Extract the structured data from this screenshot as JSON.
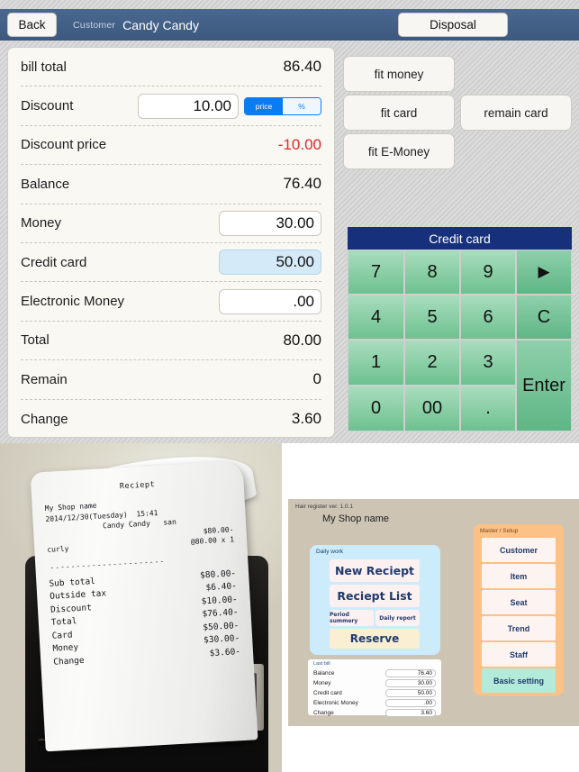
{
  "navbar": {
    "back_label": "Back",
    "customer_label": "Customer",
    "customer_name": "Candy Candy",
    "disposal_label": "Disposal"
  },
  "bill": {
    "rows": [
      {
        "label": "bill total",
        "value": "86.40"
      },
      {
        "label": "Discount",
        "value": "10.00"
      },
      {
        "label": "Discount price",
        "value": "-10.00"
      },
      {
        "label": "Balance",
        "value": "76.40"
      },
      {
        "label": "Money",
        "value": "30.00"
      },
      {
        "label": "Credit card",
        "value": "50.00"
      },
      {
        "label": "Electronic Money",
        "value": ".00"
      },
      {
        "label": "Total",
        "value": "80.00"
      },
      {
        "label": "Remain",
        "value": "0"
      },
      {
        "label": "Change",
        "value": "3.60"
      }
    ],
    "discount_mode": {
      "price_label": "price",
      "percent_label": "%",
      "selected": "price"
    }
  },
  "actions": {
    "fit_money": "fit money",
    "fit_card": "fit card",
    "fit_emoney": "fit E-Money",
    "remain_card": "remain card"
  },
  "keypad": {
    "title": "Credit card",
    "keys": [
      "7",
      "8",
      "9",
      "▶",
      "4",
      "5",
      "6",
      "C",
      "1",
      "2",
      "3",
      "0",
      "00",
      ".",
      "Enter"
    ],
    "k7": "7",
    "k8": "8",
    "k9": "9",
    "karrow": "▶",
    "k4": "4",
    "k5": "5",
    "k6": "6",
    "kc": "C",
    "k1": "1",
    "k2": "2",
    "k3": "3",
    "k0": "0",
    "k00": "00",
    "kdot": ".",
    "kenter": "Enter"
  },
  "receipt": {
    "title": "Reciept",
    "shop": "My Shop name",
    "datetime": "2014/12/30(Tuesday)  15:41",
    "customer": "Candy Candy   san",
    "item": "curly",
    "item_amount": "$80.00-",
    "item_unit": "@80.00  x 1",
    "separator": "----------------------",
    "totals": [
      {
        "label": "Sub total",
        "value": "$80.00-"
      },
      {
        "label": "Outside tax",
        "value": "$6.40-"
      },
      {
        "label": "Discount",
        "value": "$10.00-"
      },
      {
        "label": "Total",
        "value": "$76.40-"
      },
      {
        "label": "Card",
        "value": "$50.00-"
      },
      {
        "label": "Money",
        "value": "$30.00-"
      },
      {
        "label": "Change",
        "value": "$3.60-"
      }
    ]
  },
  "home": {
    "version": "Hair register ver. 1.0.1",
    "shop_name": "My Shop name",
    "daily_work": {
      "caption": "Daily work",
      "new_reciept": "New Reciept",
      "reciept_list": "Reciept List",
      "period_summery": "Period summery",
      "daily_report": "Daily report",
      "reserve": "Reserve"
    },
    "last_bill": {
      "caption": "Last bill",
      "rows": [
        {
          "label": "Balance",
          "value": "76.40"
        },
        {
          "label": "Money",
          "value": "30.00"
        },
        {
          "label": "Credit card",
          "value": "50.00"
        },
        {
          "label": "Electronic Money",
          "value": ".00"
        },
        {
          "label": "Change",
          "value": "3.60"
        }
      ]
    },
    "master": {
      "caption": "Master / Setup",
      "customer": "Customer",
      "item": "Item",
      "seat": "Seat",
      "trend": "Trend",
      "staff": "Staff",
      "basic_setting": "Basic setting"
    }
  },
  "colors": {
    "navbar": "#43618a",
    "accent_blue": "#0a7cf0",
    "keypad_header": "#16307c",
    "negative": "#e8252a",
    "key_green_top": "#a9ddbe",
    "key_green_bottom": "#6dc190",
    "home_bg": "#cdc4b4",
    "daily_panel": "#ccecfb",
    "master_panel": "#fbc187",
    "basic_setting": "#b4ead9"
  }
}
